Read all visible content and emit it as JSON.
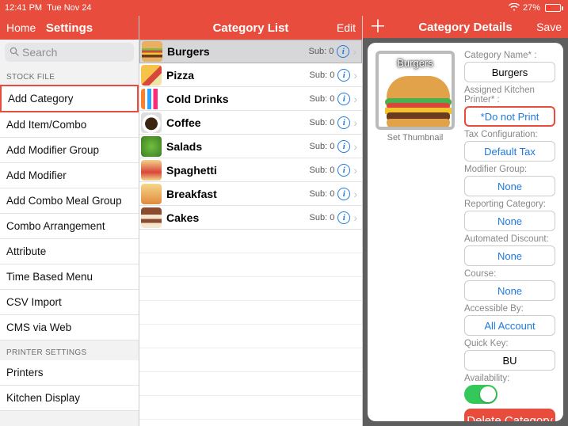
{
  "statusbar": {
    "time": "12:41 PM",
    "date": "Tue Nov 24",
    "battery": "27%"
  },
  "col1": {
    "home": "Home",
    "title": "Settings",
    "search_placeholder": "Search",
    "section1": "STOCK FILE",
    "items1": [
      "Add Category",
      "Add Item/Combo",
      "Add Modifier Group",
      "Add Modifier",
      "Add Combo Meal Group",
      "Combo Arrangement",
      "Attribute",
      "Time Based Menu",
      "CSV Import",
      "CMS via Web"
    ],
    "selected1": 0,
    "section2": "PRINTER SETTINGS",
    "items2": [
      "Printers",
      "Kitchen Display"
    ]
  },
  "col2": {
    "title": "Category List",
    "edit": "Edit",
    "items": [
      {
        "name": "Burgers",
        "sub": "Sub: 0",
        "color": "linear-gradient(#e8b060 0 35%,#7fbf3f 35% 45%,#c94d3e 45% 55%,#f4c430 55% 65%,#6a3b1e 65% 78%,#e8b060 78% 100%)",
        "selected": true
      },
      {
        "name": "Pizza",
        "sub": "Sub: 0",
        "color": "linear-gradient(135deg,#f6c34a 0 50%,#d9463a 50% 70%,#f1e2a6 70% 100%)"
      },
      {
        "name": "Cold Drinks",
        "sub": "Sub: 0",
        "color": "linear-gradient(90deg,#ff7f2a 0 20%,#fff 20% 30%,#2aa4ff 30% 50%,#fff 50% 60%,#ff2a7a 60% 80%,#fff 80% 100%)"
      },
      {
        "name": "Coffee",
        "sub": "Sub: 0",
        "color": "radial-gradient(circle at 50% 55%, #3b2412 0 40%, #fff 42% 60%, #ddd 60% 100%)"
      },
      {
        "name": "Salads",
        "sub": "Sub: 0",
        "color": "radial-gradient(circle,#6fbf3f,#3e7d22)"
      },
      {
        "name": "Spaghetti",
        "sub": "Sub: 0",
        "color": "linear-gradient(#f2d48a,#d9463a 60%,#f2d48a)"
      },
      {
        "name": "Breakfast",
        "sub": "Sub: 0",
        "color": "linear-gradient(#f6d68a,#e08a3e)"
      },
      {
        "name": "Cakes",
        "sub": "Sub: 0",
        "color": "linear-gradient(#8a4b2e 0 35%,#f5e6d0 35% 55%,#8a4b2e 55% 75%,#f5e6d0 75% 100%)"
      }
    ]
  },
  "col3": {
    "plus": "＋",
    "title": "Category Details",
    "save": "Save",
    "thumb_label": "Burgers",
    "set_thumb": "Set Thumbnail",
    "fields": {
      "name_lbl": "Category Name* :",
      "name_val": "Burgers",
      "printer_lbl": "Assigned Kitchen Printer* :",
      "printer_val": "*Do not Print",
      "tax_lbl": "Tax Configuration:",
      "tax_val": "Default Tax",
      "mod_lbl": "Modifier Group:",
      "mod_val": "None",
      "report_lbl": "Reporting Category:",
      "report_val": "None",
      "auto_lbl": "Automated Discount:",
      "auto_val": "None",
      "course_lbl": "Course:",
      "course_val": "None",
      "access_lbl": "Accessible By:",
      "access_val": "All Account",
      "quick_lbl": "Quick Key:",
      "quick_val": "BU",
      "avail_lbl": "Availability:",
      "delete": "Delete Category"
    }
  }
}
